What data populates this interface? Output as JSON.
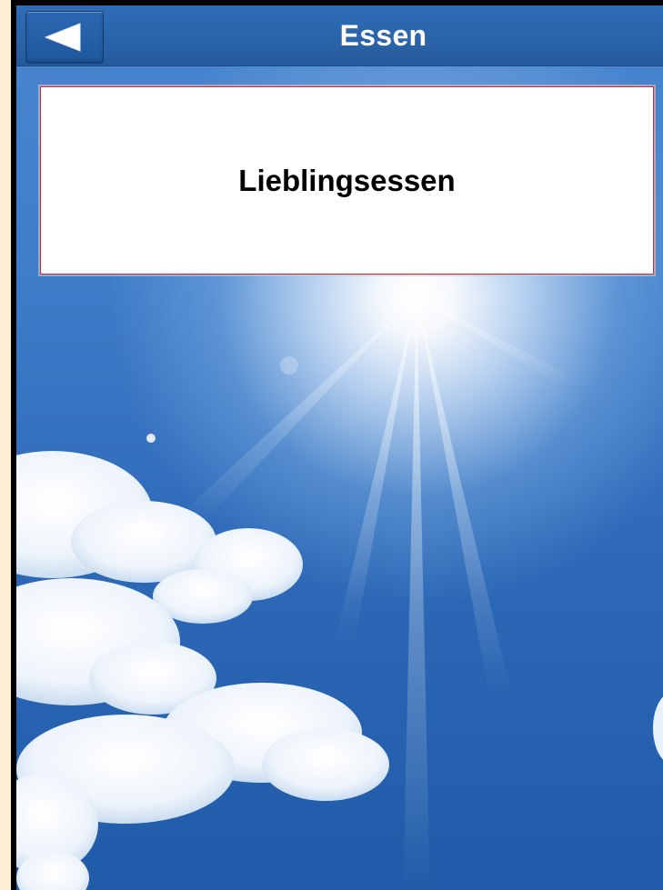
{
  "header": {
    "title": "Essen",
    "back_icon": "back-triangle-icon"
  },
  "main": {
    "card_label": "Lieblingsessen"
  },
  "colors": {
    "header_bar": "#2a63a8",
    "card_border": "#d6262c",
    "frame": "#000000",
    "outer_background": "#fdf3df"
  },
  "background": {
    "description": "blue sky with sun and clouds"
  }
}
